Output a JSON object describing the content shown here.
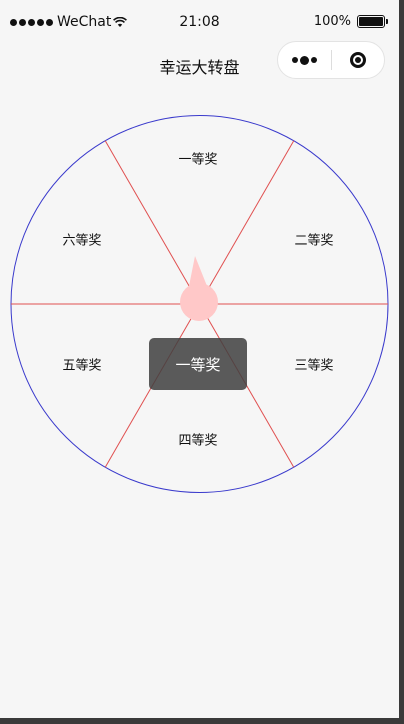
{
  "status": {
    "carrier": "WeChat",
    "time": "21:08",
    "battery": "100%"
  },
  "nav": {
    "title": "幸运大转盘"
  },
  "wheel": {
    "prizes": [
      "一等奖",
      "二等奖",
      "三等奖",
      "四等奖",
      "五等奖",
      "六等奖"
    ]
  },
  "toast": {
    "text": "一等奖"
  },
  "colors": {
    "circle": "#3a3acc",
    "dividers": "#e05050",
    "pointer": "#ffc8c8"
  }
}
